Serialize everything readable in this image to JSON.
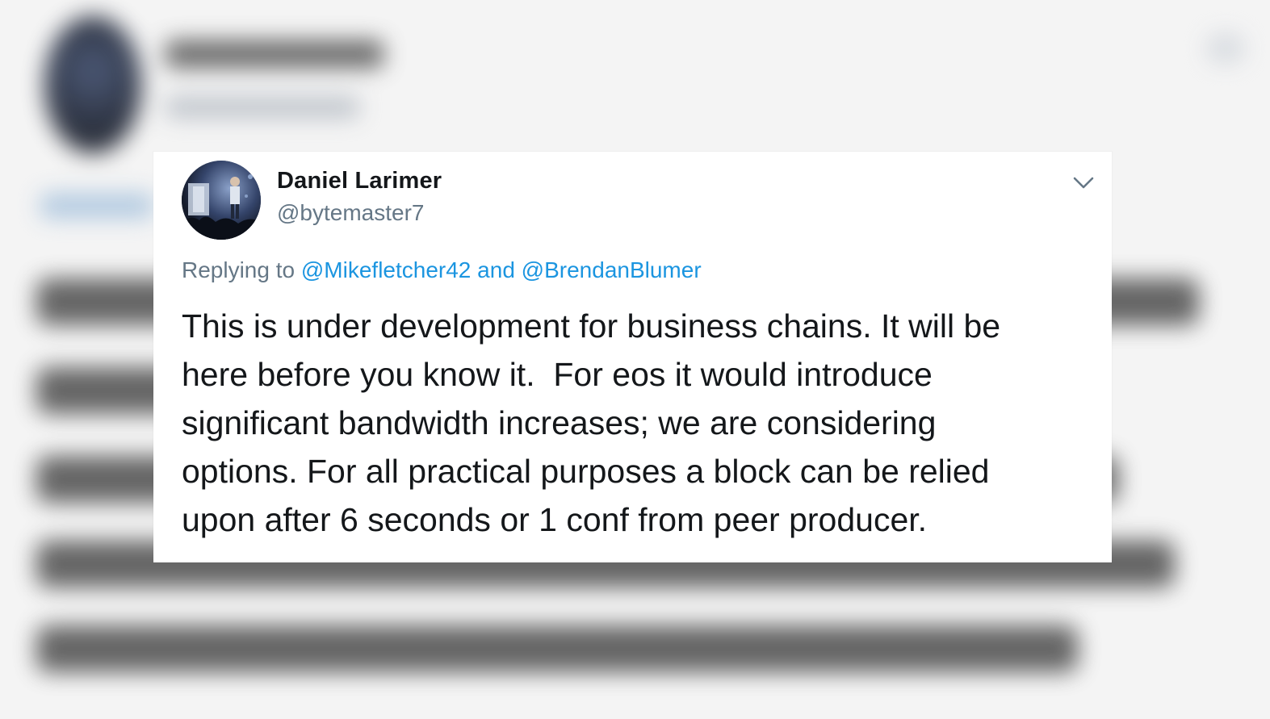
{
  "tweet": {
    "display_name": "Daniel Larimer",
    "handle": "@bytemaster7",
    "reply_prefix": "Replying to",
    "reply_mentions": [
      "@Mikefletcher42",
      "@BrendanBlumer"
    ],
    "reply_conjunction": "and",
    "text_lines": [
      "This is under development for business chains. It will be",
      "here before you know it.  For eos it would introduce",
      "significant bandwidth increases; we are considering",
      "options. For all practical purposes a block can be relied",
      "upon after 6 seconds or 1 conf from peer producer."
    ]
  },
  "icons": {
    "menu": "chevron-down-icon",
    "avatar": "profile-photo"
  },
  "colors": {
    "link": "#1b95e0",
    "secondary_text": "#657786",
    "primary_text": "#14171a",
    "card_background": "#ffffff"
  }
}
